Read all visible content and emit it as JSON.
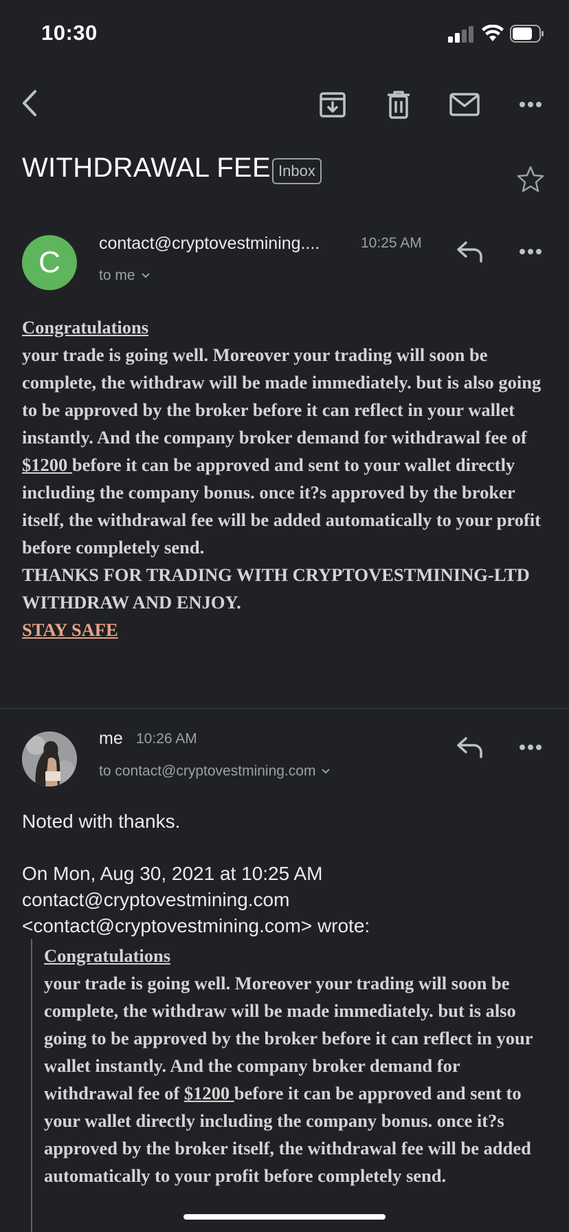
{
  "status_bar": {
    "time": "10:30"
  },
  "toolbar": {
    "back_icon": "chevron-left-icon",
    "archive_icon": "archive-icon",
    "delete_icon": "trash-icon",
    "mark_unread_icon": "mail-icon",
    "more_icon": "more-horizontal-icon"
  },
  "thread": {
    "subject": "WITHDRAWAL FEE",
    "label": "Inbox",
    "star_icon": "star-outline-icon"
  },
  "message1": {
    "avatar_letter": "C",
    "avatar_color": "#5eb55b",
    "sender": "contact@cryptovestmining....",
    "time": "10:25 AM",
    "to": "to me",
    "body": {
      "heading": "Congratulations",
      "text_before_amount": "your trade is going well. Moreover your trading will soon be complete, the withdraw will be made immediately. but is also going to be approved by the broker before it can reflect in your wallet instantly. And the company broker demand for withdrawal fee of ",
      "amount": "$1200 ",
      "text_after_amount": "before it can be approved and sent to your wallet directly including the company bonus. once it?s approved by the broker itself, the withdrawal fee will be added automatically to your profit before completely send.",
      "thanks": "THANKS FOR TRADING WITH CRYPTOVESTMINING-LTD WITHDRAW AND ENJOY.",
      "stay_safe": "STAY SAFE "
    }
  },
  "message2": {
    "sender": "me",
    "time": "10:26 AM",
    "to": "to contact@cryptovestmining.com",
    "reply_text": "Noted with thanks.",
    "quote_header_1": "On Mon, Aug 30, 2021 at 10:25 AM",
    "quote_header_2": "contact@cryptovestmining.com",
    "quote_header_3": "<contact@cryptovestmining.com> wrote:",
    "quoted": {
      "heading": "Congratulations",
      "text_before_amount": "your trade is going well. Moreover your trading will soon be complete, the withdraw will be made immediately. but is also going to be approved by the broker before it can reflect in your wallet instantly. And the company broker demand for withdrawal fee of ",
      "amount": "$1200 ",
      "text_after_amount": "before it can be approved and sent to your wallet directly including the company bonus. once it?s approved by the broker itself, the withdrawal fee will be added automatically to your profit before completely send."
    }
  },
  "colors": {
    "background": "#202124",
    "stay_safe": "#e8a385",
    "avatar": "#5eb55b"
  }
}
